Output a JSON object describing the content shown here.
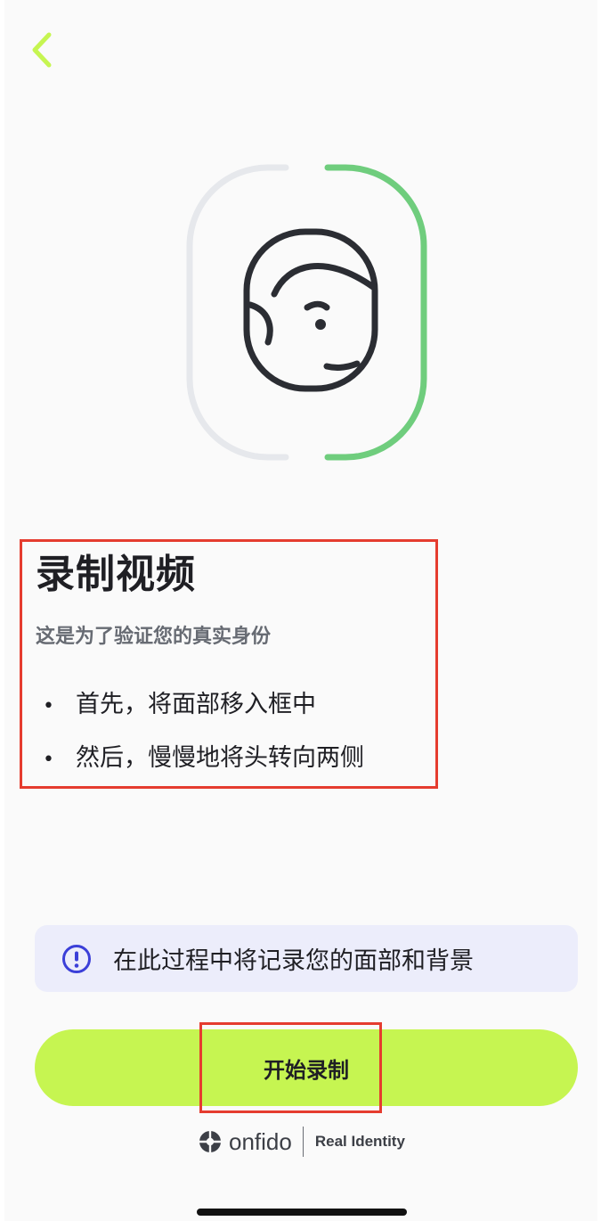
{
  "header": {
    "back_icon": "chevron-left-icon"
  },
  "intro": {
    "title": "录制视频",
    "subtitle": "这是为了验证您的真实身份",
    "instructions": [
      {
        "bullet": "•",
        "text": "首先，将面部移入框中"
      },
      {
        "bullet": "•",
        "text": "然后，慢慢地将头转向两侧"
      }
    ]
  },
  "notice": {
    "icon": "info-icon",
    "text": "在此过程中将记录您的面部和背景"
  },
  "actions": {
    "start_label": "开始录制"
  },
  "brand": {
    "name": "onfido",
    "tagline": "Real Identity"
  },
  "colors": {
    "accent": "#c6f551",
    "back_icon": "#c6f551",
    "progress_arc": "#6fcd7d",
    "frame_arc": "#e6e8ec",
    "notice_background": "#ecedfb",
    "notice_icon": "#3b3fd8",
    "annotation_box": "#e53c2f"
  }
}
